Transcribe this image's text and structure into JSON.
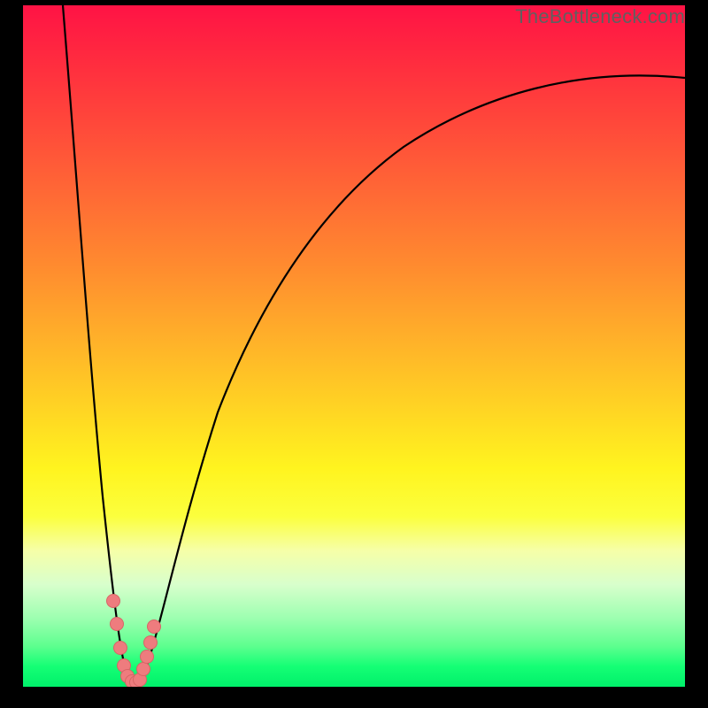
{
  "watermark": "TheBottleneck.com",
  "colors": {
    "frame": "#000000",
    "curve": "#000000",
    "marker_fill": "#ee7c7e",
    "marker_stroke": "#d86466",
    "gradient_top": "#ff1345",
    "gradient_bottom": "#00f06a"
  },
  "chart_data": {
    "type": "line",
    "title": "",
    "xlabel": "",
    "ylabel": "",
    "xlim": [
      0,
      100
    ],
    "ylim": [
      0,
      100
    ],
    "series": [
      {
        "name": "curve-left",
        "x": [
          6,
          8,
          10,
          11,
          12,
          13,
          14,
          14.5,
          15,
          15.5,
          16,
          16.5
        ],
        "values": [
          100,
          76,
          52,
          40,
          28,
          17,
          8,
          4.5,
          2,
          0.8,
          0.5,
          0.5
        ]
      },
      {
        "name": "curve-right",
        "x": [
          16.5,
          17,
          18,
          19,
          20,
          22,
          25,
          30,
          36,
          44,
          55,
          70,
          85,
          100
        ],
        "values": [
          0.5,
          0.8,
          3,
          7,
          12,
          22,
          34,
          48,
          59,
          68,
          76,
          82,
          86,
          89
        ]
      }
    ],
    "markers": {
      "name": "highlighted-points",
      "x_approx": [
        13.6,
        14.0,
        14.6,
        15.0,
        15.4,
        15.8,
        16.2,
        16.6,
        17.0,
        17.6,
        18.2,
        18.8
      ],
      "y_approx": [
        12.5,
        9.2,
        5.5,
        3.0,
        1.4,
        0.7,
        0.6,
        0.7,
        1.6,
        3.6,
        6.0,
        8.5
      ]
    }
  }
}
